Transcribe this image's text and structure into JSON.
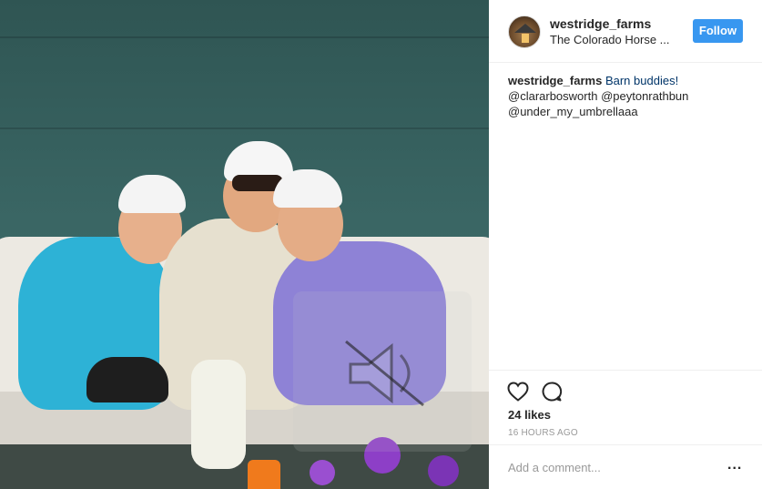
{
  "post": {
    "username": "westridge_farms",
    "location": "The Colorado Horse ...",
    "follow_label": "Follow",
    "caption": {
      "username": "westridge_farms",
      "text": "Barn buddies!",
      "mentions": [
        "@clararbosworth @peytonrathbun",
        "@under_my_umbrellaaa"
      ]
    },
    "likes": "24 likes",
    "time": "16 HOURS AGO",
    "comment_placeholder": "Add a comment...",
    "more_label": "..."
  },
  "icons": {
    "avatar": "barn-avatar-icon",
    "heart": "heart-icon",
    "comment": "comment-icon",
    "more": "more-options-icon",
    "speaker": "speaker-muted-icon"
  },
  "colors": {
    "follow_button": "#3897f0",
    "caption_link": "#003569",
    "meta_gray": "#999999",
    "divider": "#efefef"
  }
}
